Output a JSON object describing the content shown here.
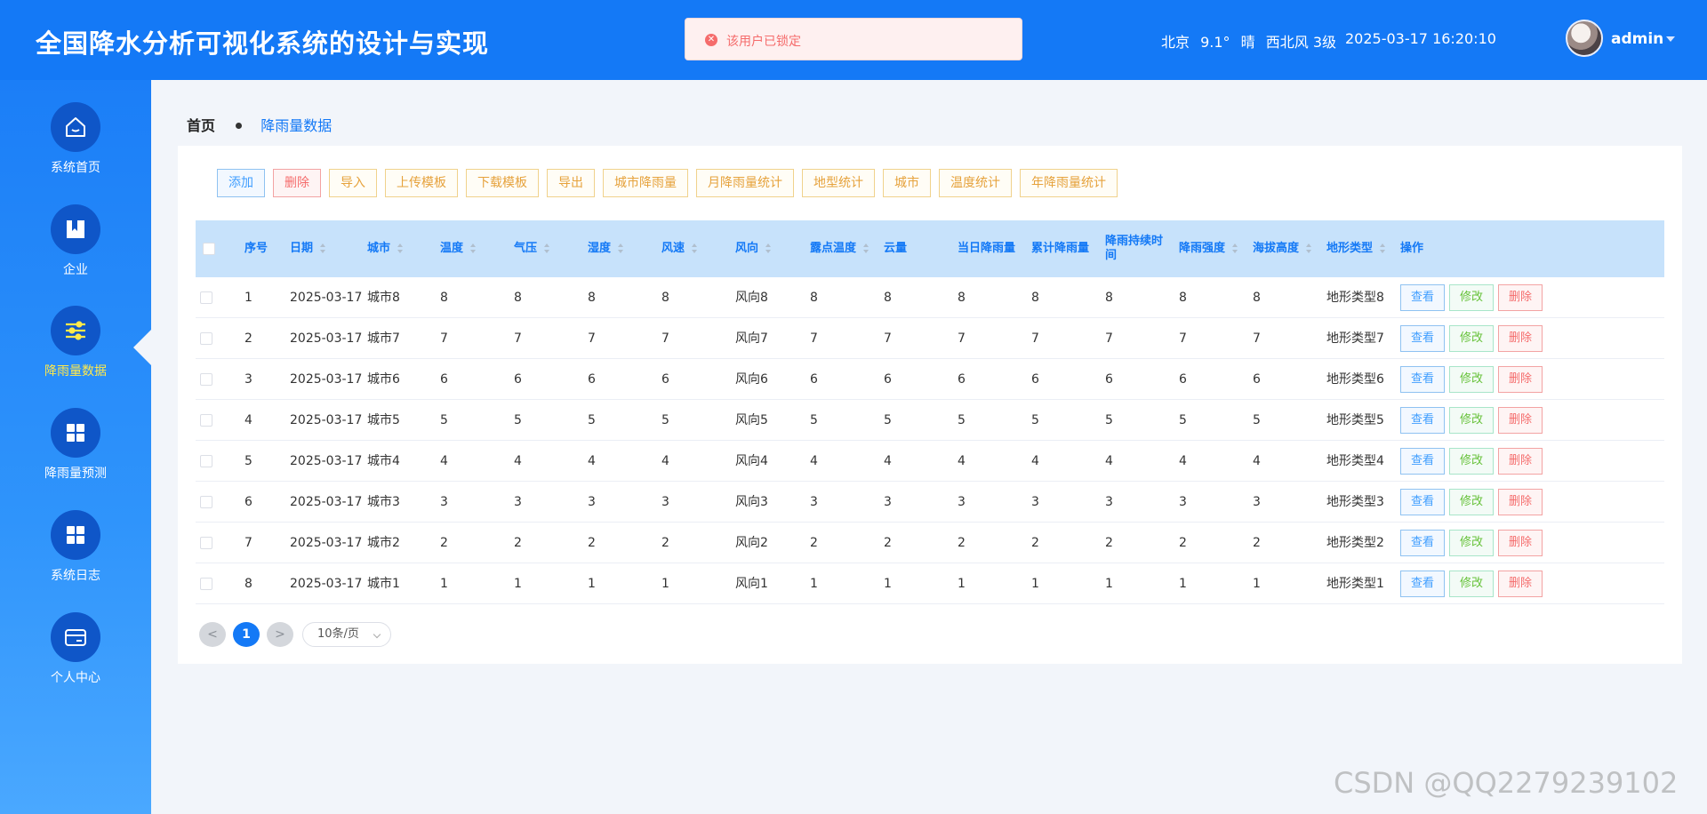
{
  "header": {
    "title": "全国降水分析可视化系统的设计与实现",
    "weather": {
      "city": "北京",
      "temp": "9.1°",
      "condition": "晴",
      "wind": "西北风 3级"
    },
    "datetime": "2025-03-17 16:20:10",
    "username": "admin"
  },
  "toast": {
    "message": "该用户已锁定",
    "type": "error"
  },
  "sidebar": {
    "items": [
      {
        "label": "系统首页",
        "icon": "home-icon"
      },
      {
        "label": "企业",
        "icon": "book-icon"
      },
      {
        "label": "降雨量数据",
        "icon": "sliders-icon",
        "active": true
      },
      {
        "label": "降雨量预测",
        "icon": "grid-icon"
      },
      {
        "label": "系统日志",
        "icon": "grid-icon"
      },
      {
        "label": "个人中心",
        "icon": "card-icon"
      }
    ]
  },
  "breadcrumb": {
    "home": "首页",
    "current": "降雨量数据"
  },
  "toolbar": {
    "buttons": [
      "添加",
      "删除",
      "导入",
      "上传模板",
      "下载模板",
      "导出",
      "城市降雨量",
      "月降雨量统计",
      "地型统计",
      "城市",
      "温度统计",
      "年降雨量统计"
    ]
  },
  "table": {
    "headers": [
      "序号",
      "日期",
      "城市",
      "温度",
      "气压",
      "湿度",
      "风速",
      "风向",
      "露点温度",
      "云量",
      "当日降雨量",
      "累计降雨量",
      "降雨持续时间",
      "降雨强度",
      "海拔高度",
      "地形类型",
      "操作"
    ],
    "rows": [
      [
        "1",
        "2025-03-17",
        "城市8",
        "8",
        "8",
        "8",
        "8",
        "风向8",
        "8",
        "8",
        "8",
        "8",
        "8",
        "8",
        "8",
        "地形类型8"
      ],
      [
        "2",
        "2025-03-17",
        "城市7",
        "7",
        "7",
        "7",
        "7",
        "风向7",
        "7",
        "7",
        "7",
        "7",
        "7",
        "7",
        "7",
        "地形类型7"
      ],
      [
        "3",
        "2025-03-17",
        "城市6",
        "6",
        "6",
        "6",
        "6",
        "风向6",
        "6",
        "6",
        "6",
        "6",
        "6",
        "6",
        "6",
        "地形类型6"
      ],
      [
        "4",
        "2025-03-17",
        "城市5",
        "5",
        "5",
        "5",
        "5",
        "风向5",
        "5",
        "5",
        "5",
        "5",
        "5",
        "5",
        "5",
        "地形类型5"
      ],
      [
        "5",
        "2025-03-17",
        "城市4",
        "4",
        "4",
        "4",
        "4",
        "风向4",
        "4",
        "4",
        "4",
        "4",
        "4",
        "4",
        "4",
        "地形类型4"
      ],
      [
        "6",
        "2025-03-17",
        "城市3",
        "3",
        "3",
        "3",
        "3",
        "风向3",
        "3",
        "3",
        "3",
        "3",
        "3",
        "3",
        "3",
        "地形类型3"
      ],
      [
        "7",
        "2025-03-17",
        "城市2",
        "2",
        "2",
        "2",
        "2",
        "风向2",
        "2",
        "2",
        "2",
        "2",
        "2",
        "2",
        "2",
        "地形类型2"
      ],
      [
        "8",
        "2025-03-17",
        "城市1",
        "1",
        "1",
        "1",
        "1",
        "风向1",
        "1",
        "1",
        "1",
        "1",
        "1",
        "1",
        "1",
        "地形类型1"
      ]
    ],
    "actions": {
      "view": "查看",
      "edit": "修改",
      "delete": "删除"
    }
  },
  "pagination": {
    "prev": "<",
    "current": "1",
    "next": ">",
    "page_size": "10条/页"
  },
  "watermark": "CSDN @QQ2279239102",
  "colors": {
    "primary": "#1479f6",
    "warning": "#e6a23c",
    "danger": "#f56c6c",
    "success": "#67c23a",
    "active_nav": "#ffe94a"
  }
}
